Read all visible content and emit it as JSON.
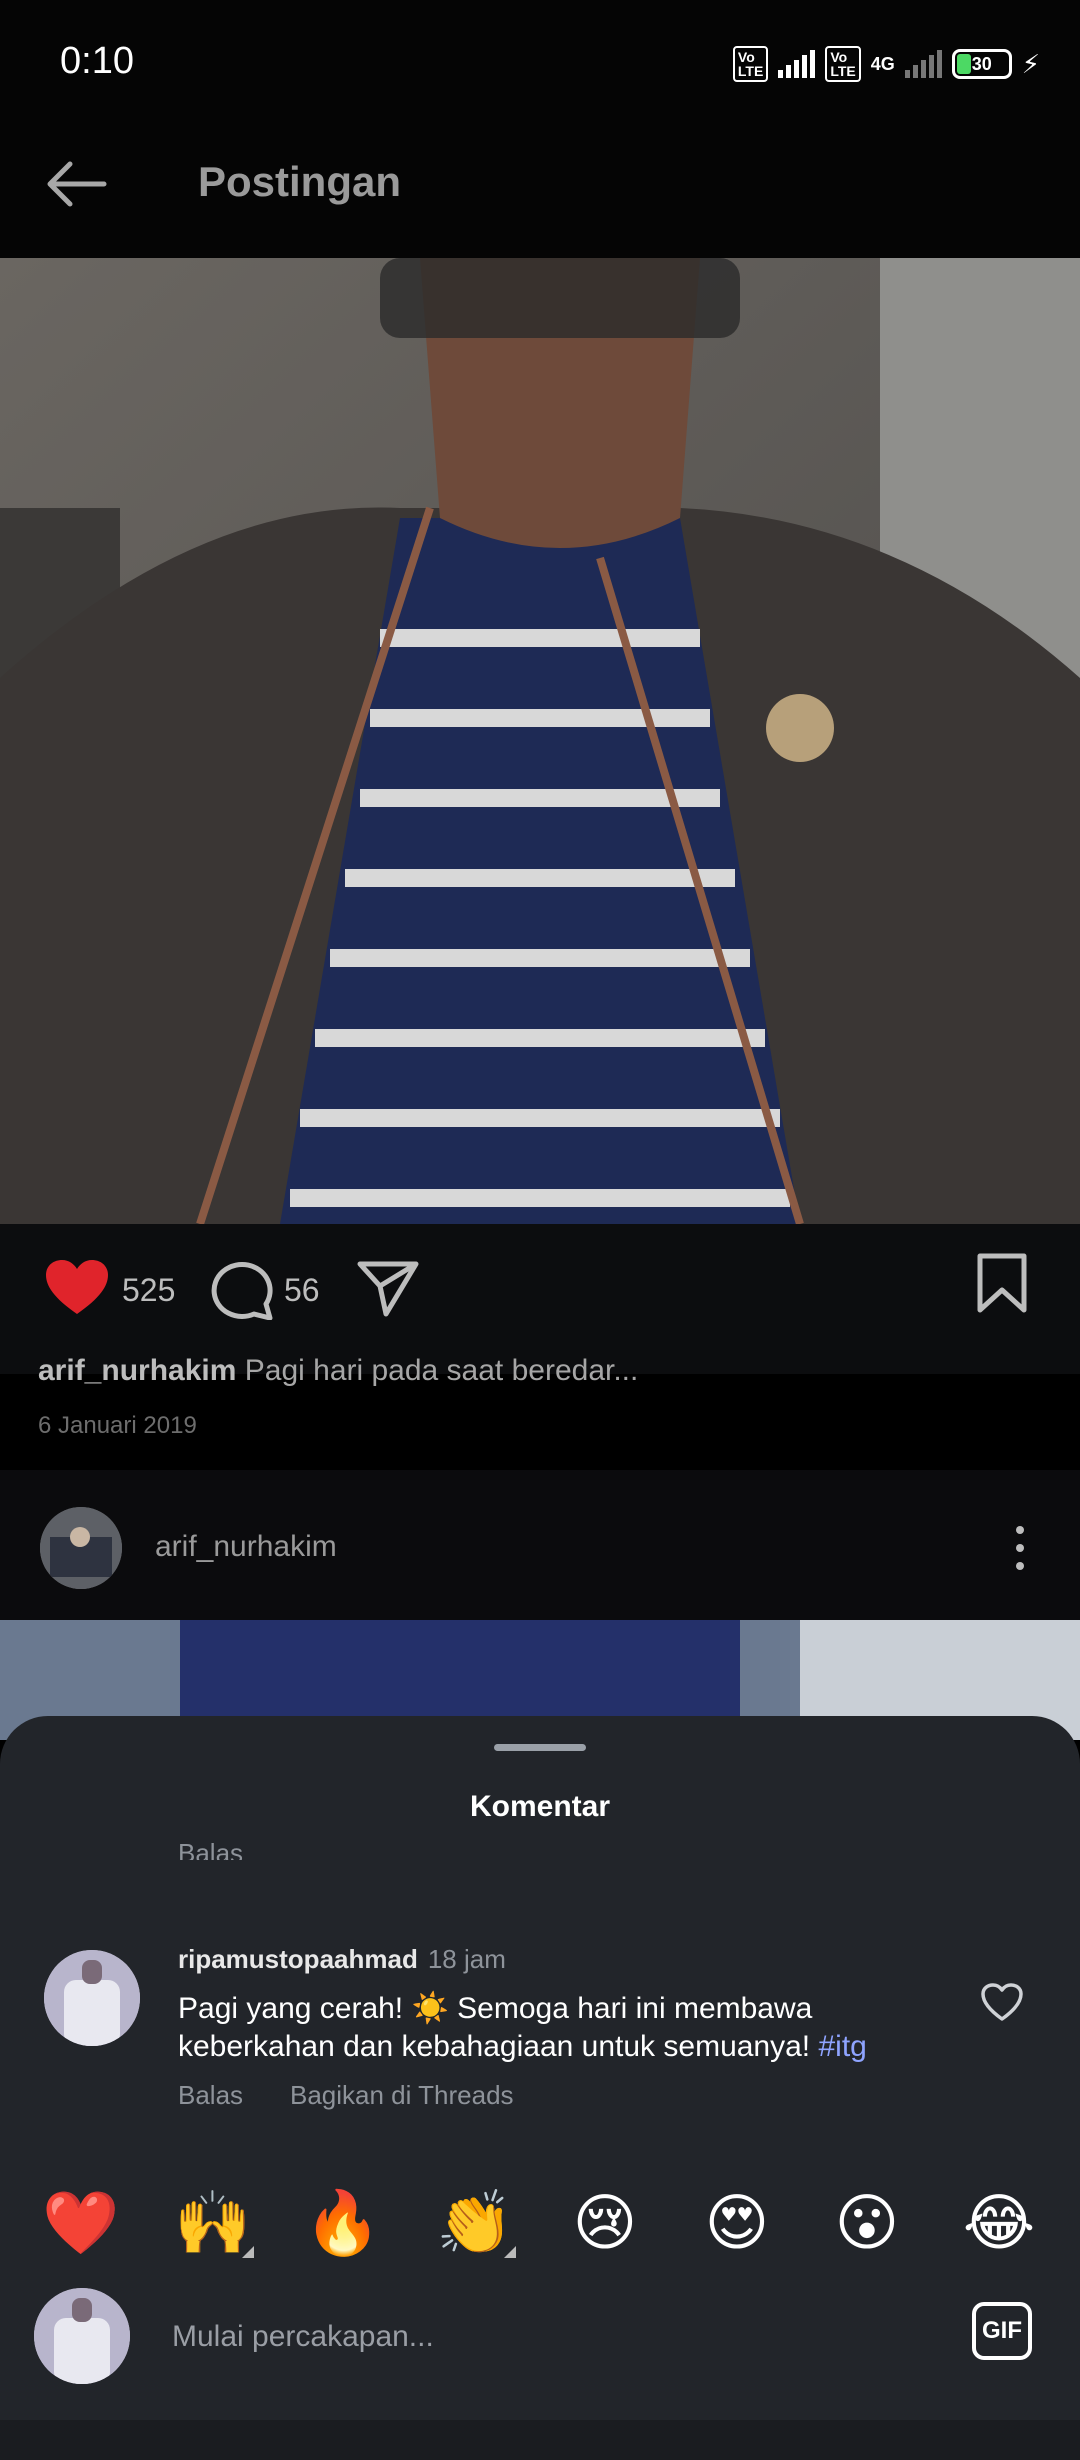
{
  "status_bar": {
    "time": "0:10",
    "volte_1": "Vo LTE",
    "volte_2": "Vo LTE",
    "network": "4G",
    "battery": "30"
  },
  "header": {
    "title": "Postingan"
  },
  "post": {
    "likes": "525",
    "comments": "56",
    "caption_user": "arif_nurhakim",
    "caption_text": "Pagi hari pada saat beredar...",
    "date": "6 Januari 2019",
    "like_color": "#e0242b"
  },
  "next_post": {
    "username": "arif_nurhakim"
  },
  "comments_sheet": {
    "title": "Komentar",
    "peek_reply": "Balas",
    "comment": {
      "username": "ripamustopaahmad",
      "time": "18 jam",
      "text": "Pagi yang cerah! ☀️ Semoga hari ini membawa keberkahan dan kebahagiaan untuk semuanya! ",
      "hashtag": "#itg",
      "reply_label": "Balas",
      "share_label": "Bagikan di Threads"
    },
    "emojis": [
      "❤️",
      "🙌",
      "🔥",
      "👏",
      "😢",
      "😍",
      "😮",
      "😂"
    ],
    "input_placeholder": "Mulai percakapan...",
    "gif_label": "GIF"
  },
  "icons": {
    "back": "arrow-left-icon",
    "like": "heart-icon",
    "comment": "speech-bubble-icon",
    "share": "paper-plane-icon",
    "save": "bookmark-icon",
    "more": "vertical-dots-icon"
  }
}
